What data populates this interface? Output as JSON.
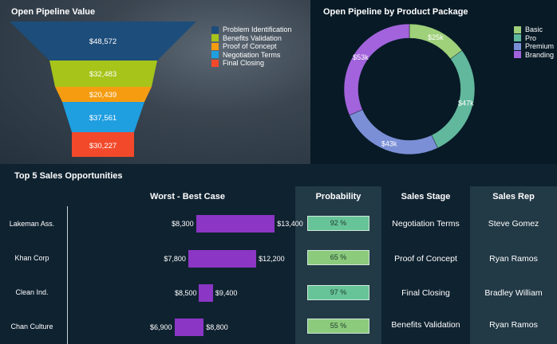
{
  "funnel_panel": {
    "title": "Open Pipeline Value",
    "chart_data": {
      "type": "funnel",
      "categories": [
        "Problem Identification",
        "Benefits Validation",
        "Proof of Concept",
        "Negotiation Terms",
        "Final Closing"
      ],
      "values": [
        "$48,572",
        "$32,483",
        "$20,439",
        "$37,561",
        "$30,227"
      ],
      "colors": [
        "#1d4d7a",
        "#a6c41a",
        "#f59c11",
        "#1f9ee0",
        "#f2492a"
      ]
    }
  },
  "donut_panel": {
    "title": "Open Pipeline by Product Package",
    "chart_data": {
      "type": "pie",
      "categories": [
        "Basic",
        "Pro",
        "Premium",
        "Branding"
      ],
      "values": [
        25,
        47,
        43,
        53
      ],
      "labels": [
        "$25k",
        "$47k",
        "$43k",
        "$53k"
      ],
      "colors": [
        "#9fd07a",
        "#62b89c",
        "#7b8fd6",
        "#a263dc"
      ]
    }
  },
  "table_panel": {
    "title": "Top 5 Sales Opportunities",
    "headers": {
      "range": "Worst - Best Case",
      "probability": "Probability",
      "stage": "Sales Stage",
      "rep": "Sales Rep"
    },
    "rows": [
      {
        "company": "Lakeman Ass.",
        "worst": "$8,300",
        "best": "$13,400",
        "probability": "92 %",
        "stage": "Negotiation Terms",
        "rep": "Steve Gomez"
      },
      {
        "company": "Khan Corp",
        "worst": "$7,800",
        "best": "$12,200",
        "probability": "65 %",
        "stage": "Proof of Concept",
        "rep": "Ryan Ramos"
      },
      {
        "company": "Clean Ind.",
        "worst": "$8,500",
        "best": "$9,400",
        "probability": "97 %",
        "stage": "Final Closing",
        "rep": "Bradley William"
      },
      {
        "company": "Chan Culture",
        "worst": "$6,900",
        "best": "$8,800",
        "probability": "55 %",
        "stage": "Benefits Validation",
        "rep": "Ryan Ramos"
      }
    ],
    "chart_data": {
      "type": "bar",
      "categories": [
        "Lakeman Ass.",
        "Khan Corp",
        "Clean Ind.",
        "Chan Culture"
      ],
      "worst": [
        8300,
        7800,
        8500,
        6900
      ],
      "best": [
        13400,
        12200,
        9400,
        8800
      ],
      "bar_color": "#8b36c4"
    },
    "probability_values": [
      0.92,
      0.65,
      0.97,
      0.55
    ],
    "probability_colors": [
      "#67c498",
      "#8ccb7c",
      "#67c498",
      "#8ccb7c"
    ]
  }
}
